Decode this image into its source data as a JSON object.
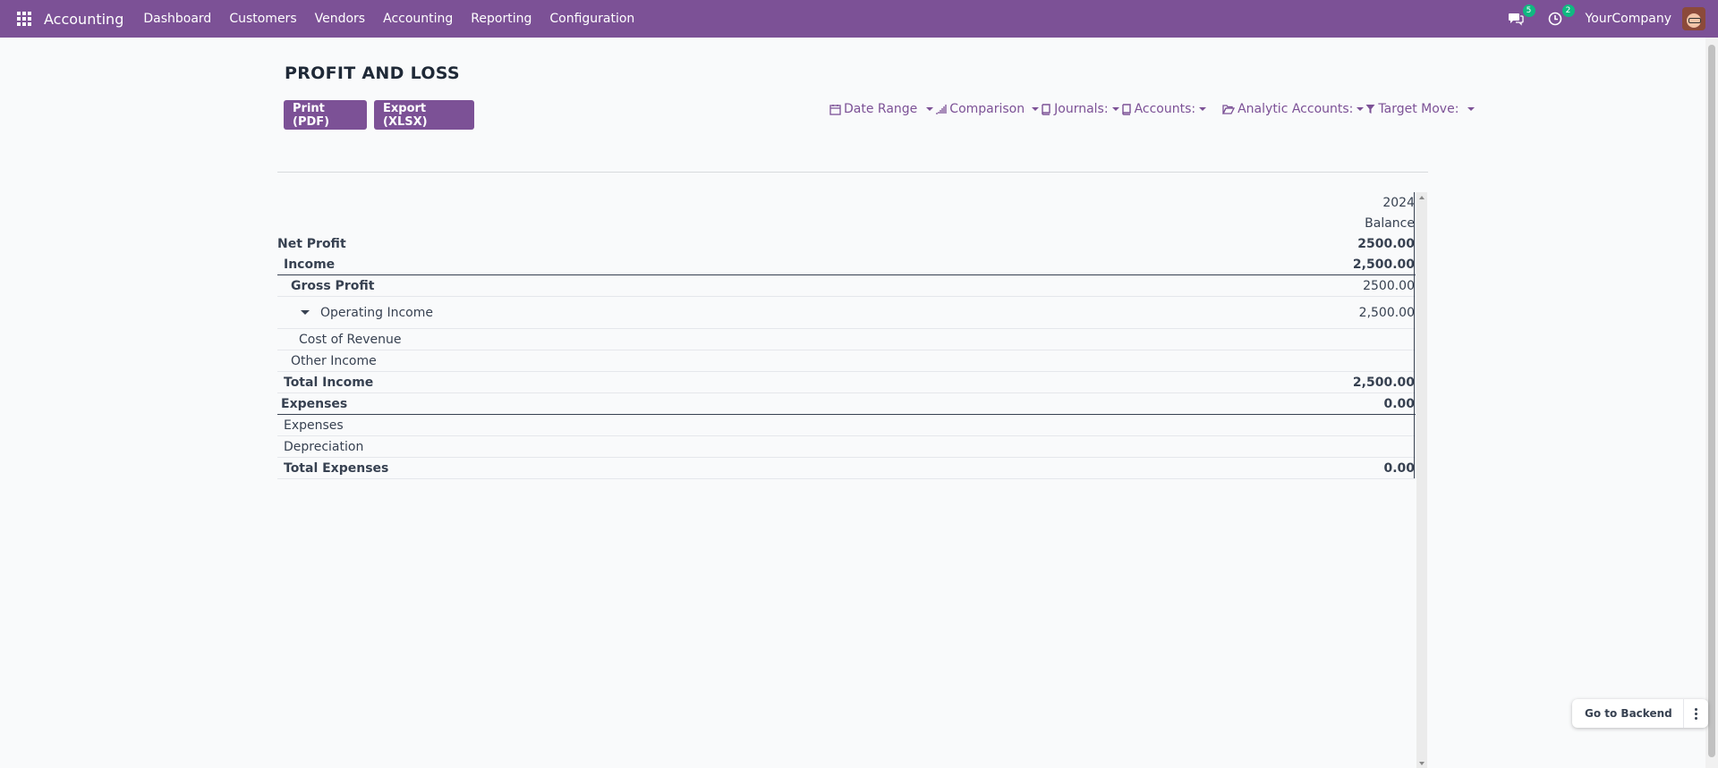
{
  "navbar": {
    "app_name": "Accounting",
    "menu": [
      "Dashboard",
      "Customers",
      "Vendors",
      "Accounting",
      "Reporting",
      "Configuration"
    ],
    "messages_count": "5",
    "activities_count": "2",
    "company": "YourCompany",
    "accent_color": "#7c5196"
  },
  "report": {
    "title": "PROFIT AND LOSS",
    "print_label": "Print (PDF)",
    "export_label": "Export (XLSX)",
    "filters": {
      "date_range": "Date Range",
      "comparison": "Comparison",
      "journals": "Journals:",
      "accounts": "Accounts:",
      "analytic_accounts": "Analytic Accounts:",
      "target_move": "Target Move:"
    },
    "column_year": "2024",
    "column_label": "Balance",
    "rows": [
      {
        "label": "Net Profit",
        "value": "2500.00"
      },
      {
        "label": "Income",
        "value": "2,500.00"
      },
      {
        "label": "Gross Profit",
        "value": "2500.00"
      },
      {
        "label": "Operating Income",
        "value": "2,500.00"
      },
      {
        "label": "Cost of Revenue",
        "value": ""
      },
      {
        "label": "Other Income",
        "value": ""
      },
      {
        "label": "Total Income",
        "value": "2,500.00"
      },
      {
        "label": "Expenses",
        "value": "0.00"
      },
      {
        "label": "Expenses",
        "value": ""
      },
      {
        "label": "Depreciation",
        "value": ""
      },
      {
        "label": "Total Expenses",
        "value": "0.00"
      }
    ]
  },
  "floating": {
    "go_to_backend": "Go to Backend"
  }
}
